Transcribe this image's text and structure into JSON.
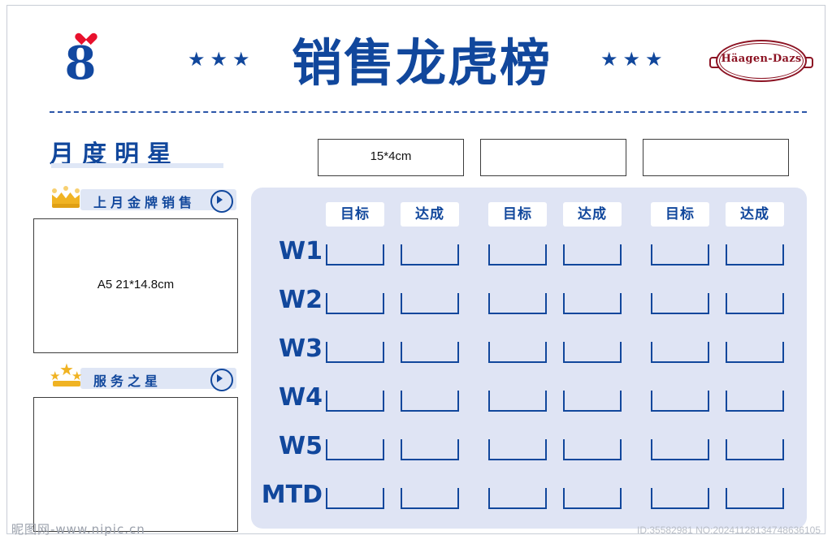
{
  "header": {
    "brand_logo_glyph": "8",
    "brand_badge_text": "Häagen-Dazs",
    "title": "销售龙虎榜",
    "stars_left": "★★★",
    "stars_right": "★★★"
  },
  "left": {
    "section_title": "月度明星",
    "blocks": [
      {
        "icon": "crown-icon",
        "label": "上月金牌销售",
        "photo_placeholder": "A5 21*14.8cm"
      },
      {
        "icon": "three-stars-icon",
        "label": "服务之星",
        "photo_placeholder": ""
      }
    ]
  },
  "spec_boxes": [
    {
      "text": "15*4cm"
    },
    {
      "text": ""
    },
    {
      "text": ""
    }
  ],
  "grid": {
    "column_groups": [
      {
        "target": "目标",
        "achieved": "达成"
      },
      {
        "target": "目标",
        "achieved": "达成"
      },
      {
        "target": "目标",
        "achieved": "达成"
      }
    ],
    "rows": [
      {
        "label": "W1",
        "values": [
          "",
          "",
          "",
          "",
          "",
          ""
        ]
      },
      {
        "label": "W2",
        "values": [
          "",
          "",
          "",
          "",
          "",
          ""
        ]
      },
      {
        "label": "W3",
        "values": [
          "",
          "",
          "",
          "",
          "",
          ""
        ]
      },
      {
        "label": "W4",
        "values": [
          "",
          "",
          "",
          "",
          "",
          ""
        ]
      },
      {
        "label": "W5",
        "values": [
          "",
          "",
          "",
          "",
          "",
          ""
        ]
      },
      {
        "label": "MTD",
        "values": [
          "",
          "",
          "",
          "",
          "",
          ""
        ]
      }
    ]
  },
  "footer": {
    "watermark_left": "昵图网-www.nipic.cn",
    "watermark_right": "ID:35582981 NO:20241128134748636105"
  },
  "colors": {
    "brand_blue": "#11479c",
    "panel_bg": "#dfe4f4",
    "gold": "#f0b323",
    "badge_red": "#8c1323"
  }
}
